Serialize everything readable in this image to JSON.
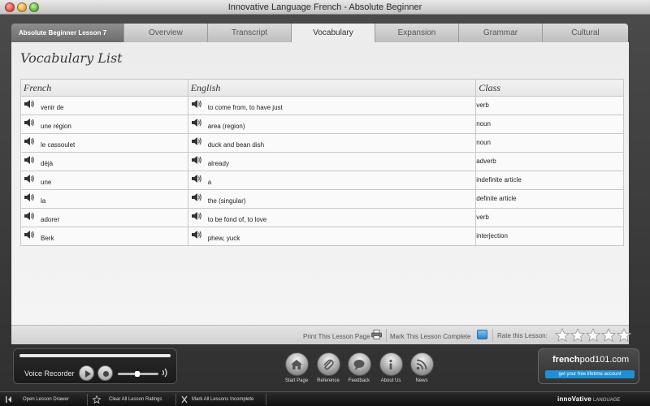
{
  "window": {
    "title": "Innovative Language French - Absolute Beginner"
  },
  "tabs": {
    "lesson_label": "Absolute Beginner Lesson 7",
    "items": [
      {
        "label": "Overview"
      },
      {
        "label": "Transcript"
      },
      {
        "label": "Vocabulary"
      },
      {
        "label": "Expansion"
      },
      {
        "label": "Grammar"
      },
      {
        "label": "Cultural"
      }
    ],
    "active": "Vocabulary"
  },
  "vocabulary": {
    "title": "Vocabulary List",
    "columns": {
      "french": "French",
      "english": "English",
      "class": "Class"
    },
    "rows": [
      {
        "french": "venir de",
        "english": "to come from, to have just",
        "class": "verb"
      },
      {
        "french": "une région",
        "english": "area (region)",
        "class": "noun"
      },
      {
        "french": "le cassoulet",
        "english": "duck and bean dish",
        "class": "noun"
      },
      {
        "french": "déjà",
        "english": "already",
        "class": "adverb"
      },
      {
        "french": "une",
        "english": "a",
        "class": "indefinite article"
      },
      {
        "french": "la",
        "english": "the (singular)",
        "class": "definite article"
      },
      {
        "french": "adorer",
        "english": "to be fond of, to love",
        "class": "verb"
      },
      {
        "french": "Berk",
        "english": "phew, yuck",
        "class": "interjection"
      }
    ]
  },
  "footer": {
    "print_label": "Print This Lesson Page",
    "mark_complete_label": "Mark This Lesson Complete",
    "rate_label": "Rate this Lesson:",
    "rating": 0,
    "max_rating": 5
  },
  "recorder": {
    "label": "Voice Recorder"
  },
  "nav": [
    {
      "label": "Start Page",
      "icon": "house-icon"
    },
    {
      "label": "Reference",
      "icon": "paperclip-icon"
    },
    {
      "label": "Feedback",
      "icon": "speech-bubble-icon"
    },
    {
      "label": "About Us",
      "icon": "info-icon"
    },
    {
      "label": "News",
      "icon": "rss-icon"
    }
  ],
  "promo": {
    "site_bold": "french",
    "site_rest": "pod101.com",
    "button": "get your free lifetime account"
  },
  "statusbar": {
    "open_drawer": "Open Lesson Drawer",
    "clear_ratings": "Clear All Lesson Ratings",
    "mark_incomplete": "Mark All Lessons Incomplete",
    "brand_bold": "innoVative",
    "brand_rest": "LANGUAGE"
  },
  "colors": {
    "accent": "#1f8fd6",
    "frame": "#3d3d3d",
    "panel": "#ececec"
  }
}
